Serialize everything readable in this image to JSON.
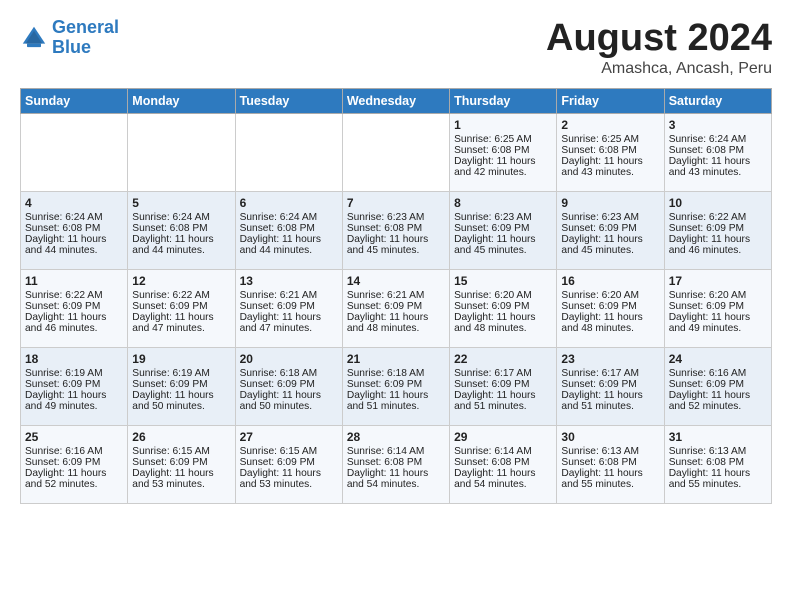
{
  "logo": {
    "line1": "General",
    "line2": "Blue"
  },
  "title": "August 2024",
  "subtitle": "Amashca, Ancash, Peru",
  "days_header": [
    "Sunday",
    "Monday",
    "Tuesday",
    "Wednesday",
    "Thursday",
    "Friday",
    "Saturday"
  ],
  "weeks": [
    [
      {
        "day": "",
        "info": ""
      },
      {
        "day": "",
        "info": ""
      },
      {
        "day": "",
        "info": ""
      },
      {
        "day": "",
        "info": ""
      },
      {
        "day": "1",
        "info": "Sunrise: 6:25 AM\nSunset: 6:08 PM\nDaylight: 11 hours\nand 42 minutes."
      },
      {
        "day": "2",
        "info": "Sunrise: 6:25 AM\nSunset: 6:08 PM\nDaylight: 11 hours\nand 43 minutes."
      },
      {
        "day": "3",
        "info": "Sunrise: 6:24 AM\nSunset: 6:08 PM\nDaylight: 11 hours\nand 43 minutes."
      }
    ],
    [
      {
        "day": "4",
        "info": "Sunrise: 6:24 AM\nSunset: 6:08 PM\nDaylight: 11 hours\nand 44 minutes."
      },
      {
        "day": "5",
        "info": "Sunrise: 6:24 AM\nSunset: 6:08 PM\nDaylight: 11 hours\nand 44 minutes."
      },
      {
        "day": "6",
        "info": "Sunrise: 6:24 AM\nSunset: 6:08 PM\nDaylight: 11 hours\nand 44 minutes."
      },
      {
        "day": "7",
        "info": "Sunrise: 6:23 AM\nSunset: 6:08 PM\nDaylight: 11 hours\nand 45 minutes."
      },
      {
        "day": "8",
        "info": "Sunrise: 6:23 AM\nSunset: 6:09 PM\nDaylight: 11 hours\nand 45 minutes."
      },
      {
        "day": "9",
        "info": "Sunrise: 6:23 AM\nSunset: 6:09 PM\nDaylight: 11 hours\nand 45 minutes."
      },
      {
        "day": "10",
        "info": "Sunrise: 6:22 AM\nSunset: 6:09 PM\nDaylight: 11 hours\nand 46 minutes."
      }
    ],
    [
      {
        "day": "11",
        "info": "Sunrise: 6:22 AM\nSunset: 6:09 PM\nDaylight: 11 hours\nand 46 minutes."
      },
      {
        "day": "12",
        "info": "Sunrise: 6:22 AM\nSunset: 6:09 PM\nDaylight: 11 hours\nand 47 minutes."
      },
      {
        "day": "13",
        "info": "Sunrise: 6:21 AM\nSunset: 6:09 PM\nDaylight: 11 hours\nand 47 minutes."
      },
      {
        "day": "14",
        "info": "Sunrise: 6:21 AM\nSunset: 6:09 PM\nDaylight: 11 hours\nand 48 minutes."
      },
      {
        "day": "15",
        "info": "Sunrise: 6:20 AM\nSunset: 6:09 PM\nDaylight: 11 hours\nand 48 minutes."
      },
      {
        "day": "16",
        "info": "Sunrise: 6:20 AM\nSunset: 6:09 PM\nDaylight: 11 hours\nand 48 minutes."
      },
      {
        "day": "17",
        "info": "Sunrise: 6:20 AM\nSunset: 6:09 PM\nDaylight: 11 hours\nand 49 minutes."
      }
    ],
    [
      {
        "day": "18",
        "info": "Sunrise: 6:19 AM\nSunset: 6:09 PM\nDaylight: 11 hours\nand 49 minutes."
      },
      {
        "day": "19",
        "info": "Sunrise: 6:19 AM\nSunset: 6:09 PM\nDaylight: 11 hours\nand 50 minutes."
      },
      {
        "day": "20",
        "info": "Sunrise: 6:18 AM\nSunset: 6:09 PM\nDaylight: 11 hours\nand 50 minutes."
      },
      {
        "day": "21",
        "info": "Sunrise: 6:18 AM\nSunset: 6:09 PM\nDaylight: 11 hours\nand 51 minutes."
      },
      {
        "day": "22",
        "info": "Sunrise: 6:17 AM\nSunset: 6:09 PM\nDaylight: 11 hours\nand 51 minutes."
      },
      {
        "day": "23",
        "info": "Sunrise: 6:17 AM\nSunset: 6:09 PM\nDaylight: 11 hours\nand 51 minutes."
      },
      {
        "day": "24",
        "info": "Sunrise: 6:16 AM\nSunset: 6:09 PM\nDaylight: 11 hours\nand 52 minutes."
      }
    ],
    [
      {
        "day": "25",
        "info": "Sunrise: 6:16 AM\nSunset: 6:09 PM\nDaylight: 11 hours\nand 52 minutes."
      },
      {
        "day": "26",
        "info": "Sunrise: 6:15 AM\nSunset: 6:09 PM\nDaylight: 11 hours\nand 53 minutes."
      },
      {
        "day": "27",
        "info": "Sunrise: 6:15 AM\nSunset: 6:09 PM\nDaylight: 11 hours\nand 53 minutes."
      },
      {
        "day": "28",
        "info": "Sunrise: 6:14 AM\nSunset: 6:08 PM\nDaylight: 11 hours\nand 54 minutes."
      },
      {
        "day": "29",
        "info": "Sunrise: 6:14 AM\nSunset: 6:08 PM\nDaylight: 11 hours\nand 54 minutes."
      },
      {
        "day": "30",
        "info": "Sunrise: 6:13 AM\nSunset: 6:08 PM\nDaylight: 11 hours\nand 55 minutes."
      },
      {
        "day": "31",
        "info": "Sunrise: 6:13 AM\nSunset: 6:08 PM\nDaylight: 11 hours\nand 55 minutes."
      }
    ]
  ]
}
